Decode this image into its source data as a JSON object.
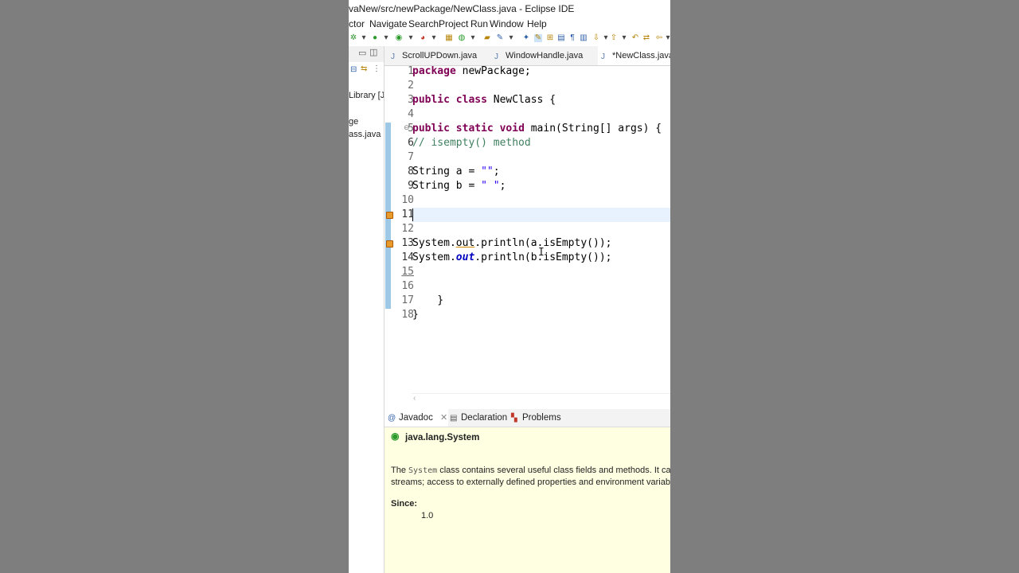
{
  "window": {
    "title": "vaNew/src/newPackage/NewClass.java - Eclipse IDE"
  },
  "menu": [
    "ctor",
    "Navigate",
    "Search",
    "Project",
    "Run",
    "Window",
    "Help"
  ],
  "toolbar_icons": [
    "run-icon",
    "debug-icon",
    "coverage-icon",
    "new-icon",
    "search-icon",
    "format-icon",
    "show-whitespace-icon",
    "next-annotation-icon",
    "back-icon",
    "forward-icon"
  ],
  "left_panel": {
    "items": [
      "Library [Ja",
      "ge",
      "ass.java"
    ]
  },
  "editor": {
    "tabs": [
      {
        "label": "ScrollUPDown.java",
        "active": false
      },
      {
        "label": "WindowHandle.java",
        "active": false
      },
      {
        "label": "*NewClass.java",
        "active": true
      }
    ],
    "line_numbers": [
      "1",
      "2",
      "3",
      "4",
      "5",
      "6",
      "7",
      "8",
      "9",
      "10",
      "11",
      "12",
      "13",
      "14",
      "15",
      "16",
      "17",
      "18"
    ],
    "lines": {
      "l1": {
        "kw": "package",
        "rest": " newPackage;"
      },
      "l3": {
        "kw1": "public",
        "kw2": "class",
        "rest": " NewClass {"
      },
      "l5": {
        "kw1": "public",
        "kw2": "static",
        "kw3": "void",
        "rest": " main(String[] args) {"
      },
      "l6": {
        "comment": "// isempty() method"
      },
      "l8": {
        "a": "String a = ",
        "str": "\"\"",
        "end": ";"
      },
      "l9": {
        "a": "String b = ",
        "str": "\" \"",
        "end": ";"
      },
      "l13": {
        "a": "System.",
        "field": "out",
        "rest": ".println(a.isEmpty());"
      },
      "l14": {
        "a": "System.",
        "field": "out",
        "rest": ".println(b.isEmpty());"
      },
      "l17": {
        "text": "    }"
      },
      "l18": {
        "text": "}"
      }
    }
  },
  "bottom_panel": {
    "tabs": [
      {
        "label": "Javadoc",
        "icon": "@",
        "active": true
      },
      {
        "label": "Declaration",
        "active": false
      },
      {
        "label": "Problems",
        "active": false
      }
    ],
    "javadoc": {
      "title": "java.lang.System",
      "p1_pre": "The ",
      "p1_code": "System",
      "p1_post": " class contains several useful class fields and methods. It ca",
      "p2": "streams; access to externally defined properties and environment variab",
      "since_label": "Since:",
      "since_value": "1.0"
    }
  },
  "colors": {
    "keyword": "#7f0055",
    "comment": "#3f7f5f",
    "string": "#2a00ff",
    "javadoc_bg": "#ffffe1"
  }
}
